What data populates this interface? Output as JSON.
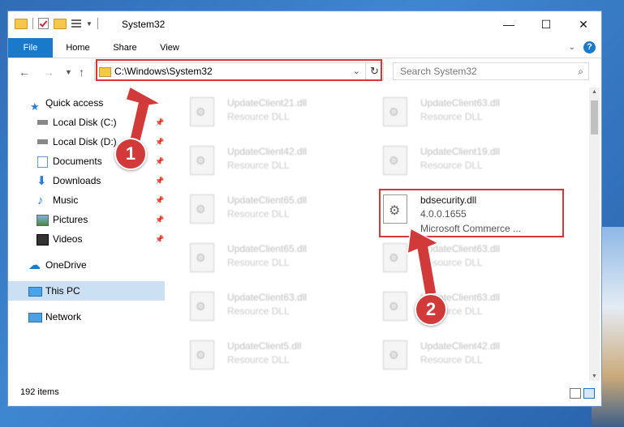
{
  "window": {
    "title": "System32",
    "controls": {
      "minimize": "—",
      "maximize": "☐",
      "close": "✕"
    }
  },
  "ribbon": {
    "tabs": [
      "File",
      "Home",
      "Share",
      "View"
    ],
    "expand_icon": "chevron-down-icon",
    "help_label": "?"
  },
  "address": {
    "path": "C:\\Windows\\System32",
    "search_placeholder": "Search System32"
  },
  "sidebar": {
    "quick_access": "Quick access",
    "items": [
      {
        "label": "Local Disk (C:)",
        "icon": "drive-icon"
      },
      {
        "label": "Local Disk (D:)",
        "icon": "drive-icon"
      },
      {
        "label": "Documents",
        "icon": "documents-icon"
      },
      {
        "label": "Downloads",
        "icon": "downloads-icon"
      },
      {
        "label": "Music",
        "icon": "music-icon"
      },
      {
        "label": "Pictures",
        "icon": "pictures-icon"
      },
      {
        "label": "Videos",
        "icon": "videos-icon"
      }
    ],
    "onedrive": "OneDrive",
    "this_pc": "This PC",
    "network": "Network"
  },
  "files": {
    "left_column": [
      {
        "name": "UpdateClient21.dll",
        "type": "Resource DLL"
      },
      {
        "name": "UpdateClient42.dll",
        "type": "Resource DLL"
      },
      {
        "name": "UpdateClient65.dll",
        "type": "Resource DLL"
      },
      {
        "name": "UpdateClient65.dll",
        "type": "Resource DLL"
      },
      {
        "name": "UpdateClient63.dll",
        "type": "Resource DLL"
      },
      {
        "name": "UpdateClient5.dll",
        "type": "Resource DLL"
      }
    ],
    "right_column": [
      {
        "name": "UpdateClient63.dll",
        "type": "Resource DLL"
      },
      {
        "name": "UpdateClient19.dll",
        "type": "Resource DLL"
      },
      {
        "name": "UpdateClient63.dll",
        "type": "Resource DLL"
      },
      {
        "name": "UpdateClient63.dll",
        "type": "Resource DLL"
      },
      {
        "name": "UpdateClient42.dll",
        "type": "Resource DLL"
      }
    ],
    "highlighted": {
      "name": "bdsecurity.dll",
      "version": "4.0.0.1655",
      "company": "Microsoft Commerce ..."
    }
  },
  "status": {
    "item_count": "192 items"
  },
  "annotations": {
    "step1": "1",
    "step2": "2",
    "accent": "#d23a3a"
  }
}
